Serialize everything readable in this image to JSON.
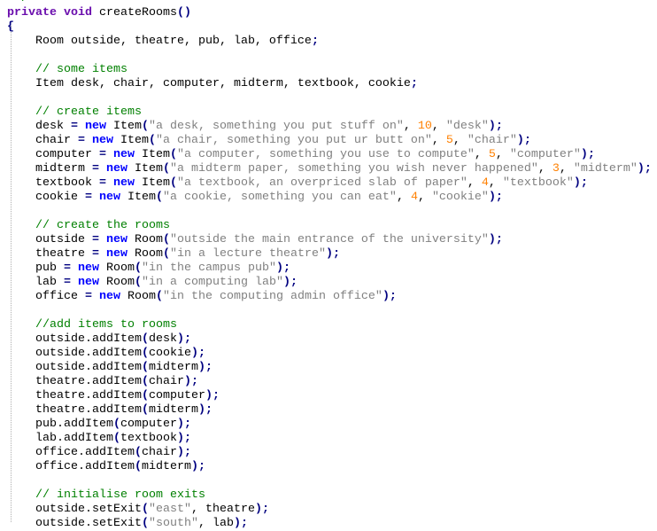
{
  "editor": {
    "language": "Java",
    "colors": {
      "keyword": "#6a0dad",
      "new": "#0000ff",
      "operator": "#000080",
      "string": "#808080",
      "number": "#ff8000",
      "comment": "#008000"
    },
    "lines": [
      [
        [
          "c",
          " */"
        ]
      ],
      [
        [
          "k",
          "private"
        ],
        [
          "t",
          " "
        ],
        [
          "k",
          "void"
        ],
        [
          "t",
          " createRooms"
        ],
        [
          "o",
          "()"
        ]
      ],
      [
        [
          "o",
          "{"
        ]
      ],
      [
        [
          "t",
          "    Room outside, theatre, pub, lab, office"
        ],
        [
          "o",
          ";"
        ]
      ],
      [],
      [
        [
          "c",
          "    // some items"
        ]
      ],
      [
        [
          "t",
          "    Item desk, chair, computer, midterm, textbook, cookie"
        ],
        [
          "o",
          ";"
        ]
      ],
      [],
      [
        [
          "c",
          "    // create items"
        ]
      ],
      [
        [
          "t",
          "    desk "
        ],
        [
          "o",
          "="
        ],
        [
          "t",
          " "
        ],
        [
          "n",
          "new"
        ],
        [
          "t",
          " Item"
        ],
        [
          "o",
          "("
        ],
        [
          "s",
          "\"a desk, something you put stuff on\""
        ],
        [
          "t",
          ", "
        ],
        [
          "d",
          "10"
        ],
        [
          "t",
          ", "
        ],
        [
          "s",
          "\"desk\""
        ],
        [
          "o",
          ");"
        ]
      ],
      [
        [
          "t",
          "    chair "
        ],
        [
          "o",
          "="
        ],
        [
          "t",
          " "
        ],
        [
          "n",
          "new"
        ],
        [
          "t",
          " Item"
        ],
        [
          "o",
          "("
        ],
        [
          "s",
          "\"a chair, something you put ur butt on\""
        ],
        [
          "t",
          ", "
        ],
        [
          "d",
          "5"
        ],
        [
          "t",
          ", "
        ],
        [
          "s",
          "\"chair\""
        ],
        [
          "o",
          ");"
        ]
      ],
      [
        [
          "t",
          "    computer "
        ],
        [
          "o",
          "="
        ],
        [
          "t",
          " "
        ],
        [
          "n",
          "new"
        ],
        [
          "t",
          " Item"
        ],
        [
          "o",
          "("
        ],
        [
          "s",
          "\"a computer, something you use to compute\""
        ],
        [
          "t",
          ", "
        ],
        [
          "d",
          "5"
        ],
        [
          "t",
          ", "
        ],
        [
          "s",
          "\"computer\""
        ],
        [
          "o",
          ");"
        ]
      ],
      [
        [
          "t",
          "    midterm "
        ],
        [
          "o",
          "="
        ],
        [
          "t",
          " "
        ],
        [
          "n",
          "new"
        ],
        [
          "t",
          " Item"
        ],
        [
          "o",
          "("
        ],
        [
          "s",
          "\"a midterm paper, something you wish never happened\""
        ],
        [
          "t",
          ", "
        ],
        [
          "d",
          "3"
        ],
        [
          "t",
          ", "
        ],
        [
          "s",
          "\"midterm\""
        ],
        [
          "o",
          ");"
        ]
      ],
      [
        [
          "t",
          "    textbook "
        ],
        [
          "o",
          "="
        ],
        [
          "t",
          " "
        ],
        [
          "n",
          "new"
        ],
        [
          "t",
          " Item"
        ],
        [
          "o",
          "("
        ],
        [
          "s",
          "\"a textbook, an overpriced slab of paper\""
        ],
        [
          "t",
          ", "
        ],
        [
          "d",
          "4"
        ],
        [
          "t",
          ", "
        ],
        [
          "s",
          "\"textbook\""
        ],
        [
          "o",
          ");"
        ]
      ],
      [
        [
          "t",
          "    cookie "
        ],
        [
          "o",
          "="
        ],
        [
          "t",
          " "
        ],
        [
          "n",
          "new"
        ],
        [
          "t",
          " Item"
        ],
        [
          "o",
          "("
        ],
        [
          "s",
          "\"a cookie, something you can eat\""
        ],
        [
          "t",
          ", "
        ],
        [
          "d",
          "4"
        ],
        [
          "t",
          ", "
        ],
        [
          "s",
          "\"cookie\""
        ],
        [
          "o",
          ");"
        ]
      ],
      [],
      [
        [
          "c",
          "    // create the rooms"
        ]
      ],
      [
        [
          "t",
          "    outside "
        ],
        [
          "o",
          "="
        ],
        [
          "t",
          " "
        ],
        [
          "n",
          "new"
        ],
        [
          "t",
          " Room"
        ],
        [
          "o",
          "("
        ],
        [
          "s",
          "\"outside the main entrance of the university\""
        ],
        [
          "o",
          ");"
        ]
      ],
      [
        [
          "t",
          "    theatre "
        ],
        [
          "o",
          "="
        ],
        [
          "t",
          " "
        ],
        [
          "n",
          "new"
        ],
        [
          "t",
          " Room"
        ],
        [
          "o",
          "("
        ],
        [
          "s",
          "\"in a lecture theatre\""
        ],
        [
          "o",
          ");"
        ]
      ],
      [
        [
          "t",
          "    pub "
        ],
        [
          "o",
          "="
        ],
        [
          "t",
          " "
        ],
        [
          "n",
          "new"
        ],
        [
          "t",
          " Room"
        ],
        [
          "o",
          "("
        ],
        [
          "s",
          "\"in the campus pub\""
        ],
        [
          "o",
          ");"
        ]
      ],
      [
        [
          "t",
          "    lab "
        ],
        [
          "o",
          "="
        ],
        [
          "t",
          " "
        ],
        [
          "n",
          "new"
        ],
        [
          "t",
          " Room"
        ],
        [
          "o",
          "("
        ],
        [
          "s",
          "\"in a computing lab\""
        ],
        [
          "o",
          ");"
        ]
      ],
      [
        [
          "t",
          "    office "
        ],
        [
          "o",
          "="
        ],
        [
          "t",
          " "
        ],
        [
          "n",
          "new"
        ],
        [
          "t",
          " Room"
        ],
        [
          "o",
          "("
        ],
        [
          "s",
          "\"in the computing admin office\""
        ],
        [
          "o",
          ");"
        ]
      ],
      [],
      [
        [
          "c",
          "    //add items to rooms"
        ]
      ],
      [
        [
          "t",
          "    outside.addItem"
        ],
        [
          "o",
          "("
        ],
        [
          "t",
          "desk"
        ],
        [
          "o",
          ");"
        ]
      ],
      [
        [
          "t",
          "    outside.addItem"
        ],
        [
          "o",
          "("
        ],
        [
          "t",
          "cookie"
        ],
        [
          "o",
          ");"
        ]
      ],
      [
        [
          "t",
          "    outside.addItem"
        ],
        [
          "o",
          "("
        ],
        [
          "t",
          "midterm"
        ],
        [
          "o",
          ");"
        ]
      ],
      [
        [
          "t",
          "    theatre.addItem"
        ],
        [
          "o",
          "("
        ],
        [
          "t",
          "chair"
        ],
        [
          "o",
          ");"
        ]
      ],
      [
        [
          "t",
          "    theatre.addItem"
        ],
        [
          "o",
          "("
        ],
        [
          "t",
          "computer"
        ],
        [
          "o",
          ");"
        ]
      ],
      [
        [
          "t",
          "    theatre.addItem"
        ],
        [
          "o",
          "("
        ],
        [
          "t",
          "midterm"
        ],
        [
          "o",
          ");"
        ]
      ],
      [
        [
          "t",
          "    pub.addItem"
        ],
        [
          "o",
          "("
        ],
        [
          "t",
          "computer"
        ],
        [
          "o",
          ");"
        ]
      ],
      [
        [
          "t",
          "    lab.addItem"
        ],
        [
          "o",
          "("
        ],
        [
          "t",
          "textbook"
        ],
        [
          "o",
          ");"
        ]
      ],
      [
        [
          "t",
          "    office.addItem"
        ],
        [
          "o",
          "("
        ],
        [
          "t",
          "chair"
        ],
        [
          "o",
          ");"
        ]
      ],
      [
        [
          "t",
          "    office.addItem"
        ],
        [
          "o",
          "("
        ],
        [
          "t",
          "midterm"
        ],
        [
          "o",
          ");"
        ]
      ],
      [],
      [
        [
          "c",
          "    // initialise room exits"
        ]
      ],
      [
        [
          "t",
          "    outside.setExit"
        ],
        [
          "o",
          "("
        ],
        [
          "s",
          "\"east\""
        ],
        [
          "t",
          ", theatre"
        ],
        [
          "o",
          ");"
        ]
      ],
      [
        [
          "t",
          "    outside.setExit"
        ],
        [
          "o",
          "("
        ],
        [
          "s",
          "\"south\""
        ],
        [
          "t",
          ", lab"
        ],
        [
          "o",
          ");"
        ]
      ]
    ]
  }
}
